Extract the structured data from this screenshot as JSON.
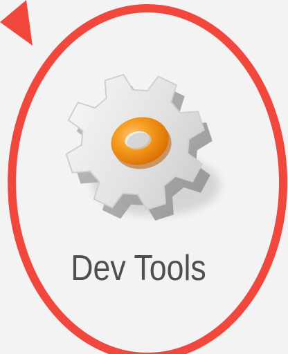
{
  "app": {
    "label": "Dev Tools",
    "icon": "gear-icon"
  },
  "annotation": {
    "shape": "ellipse",
    "color": "#f2473d",
    "pointer_icon": "arrow-pointer-icon"
  },
  "colors": {
    "background": "#f3f3f3",
    "gear": "#dcdcdc",
    "gear_center": "#f08a10",
    "label": "#4f4f4f"
  }
}
